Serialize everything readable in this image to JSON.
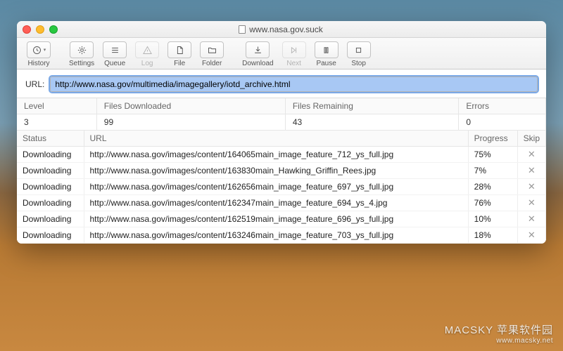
{
  "window": {
    "title": "www.nasa.gov.suck"
  },
  "toolbar": {
    "history": "History",
    "settings": "Settings",
    "queue": "Queue",
    "log": "Log",
    "file": "File",
    "folder": "Folder",
    "download": "Download",
    "next": "Next",
    "pause": "Pause",
    "stop": "Stop"
  },
  "url": {
    "label": "URL:",
    "value": "http://www.nasa.gov/multimedia/imagegallery/iotd_archive.html"
  },
  "stats": {
    "headers": {
      "level": "Level",
      "files_downloaded": "Files Downloaded",
      "files_remaining": "Files Remaining",
      "errors": "Errors"
    },
    "values": {
      "level": "3",
      "files_downloaded": "99",
      "files_remaining": "43",
      "errors": "0"
    }
  },
  "downloads": {
    "headers": {
      "status": "Status",
      "url": "URL",
      "progress": "Progress",
      "skip": "Skip"
    },
    "rows": [
      {
        "status": "Downloading",
        "url": "http://www.nasa.gov/images/content/164065main_image_feature_712_ys_full.jpg",
        "progress": "75%"
      },
      {
        "status": "Downloading",
        "url": "http://www.nasa.gov/images/content/163830main_Hawking_Griffin_Rees.jpg",
        "progress": "7%"
      },
      {
        "status": "Downloading",
        "url": "http://www.nasa.gov/images/content/162656main_image_feature_697_ys_full.jpg",
        "progress": "28%"
      },
      {
        "status": "Downloading",
        "url": "http://www.nasa.gov/images/content/162347main_image_feature_694_ys_4.jpg",
        "progress": "76%"
      },
      {
        "status": "Downloading",
        "url": "http://www.nasa.gov/images/content/162519main_image_feature_696_ys_full.jpg",
        "progress": "10%"
      },
      {
        "status": "Downloading",
        "url": "http://www.nasa.gov/images/content/163246main_image_feature_703_ys_full.jpg",
        "progress": "18%"
      }
    ]
  },
  "watermark": {
    "line1": "MACSKY 苹果软件园",
    "line2": "www.macsky.net"
  }
}
